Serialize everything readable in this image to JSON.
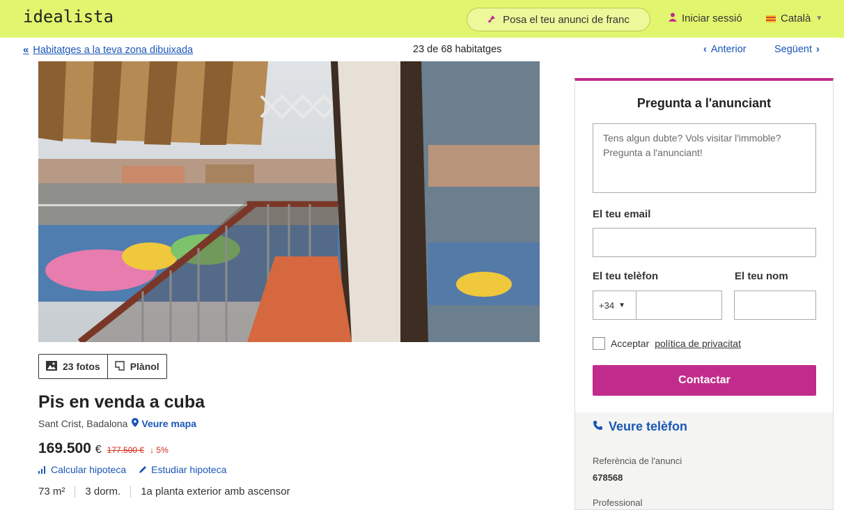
{
  "header": {
    "logo": "idealista",
    "publish_label": "Posa el teu anunci de franc",
    "login_label": "Iniciar sessió",
    "language_label": "Català",
    "accent_color": "#e1f56e"
  },
  "subnav": {
    "back_label": "Habitatges a la teva zona dibuixada",
    "counter": "23 de 68 habitatges",
    "prev_label": "Anterior",
    "next_label": "Següent"
  },
  "listing": {
    "photo_tab": "23 fotos",
    "plan_tab": "Plànol",
    "title": "Pis en venda a cuba",
    "location": "Sant Crist, Badalona",
    "map_link": "Veure mapa",
    "price": "169.500",
    "currency": "€",
    "old_price": "177.500 €",
    "price_drop": "5%",
    "calc_mortgage": "Calcular hipoteca",
    "study_mortgage": "Estudiar hipoteca",
    "features": [
      "73 m²",
      "3 dorm.",
      "1a planta exterior amb ascensor"
    ]
  },
  "contact": {
    "heading": "Pregunta a l'anunciant",
    "message_placeholder": "Tens algun dubte? Vols visitar l'immoble? Pregunta a l'anunciant!",
    "email_label": "El teu email",
    "phone_label": "El teu telèfon",
    "name_label": "El teu nom",
    "phone_prefix": "+34",
    "privacy_prefix": "Acceptar",
    "privacy_link": "política de privacitat",
    "submit_label": "Contactar",
    "show_phone": "Veure telèfon",
    "reference_label": "Referència de l'anunci",
    "reference_value": "678568",
    "advertiser_type": "Professional",
    "brand_color": "#c12b8b"
  }
}
